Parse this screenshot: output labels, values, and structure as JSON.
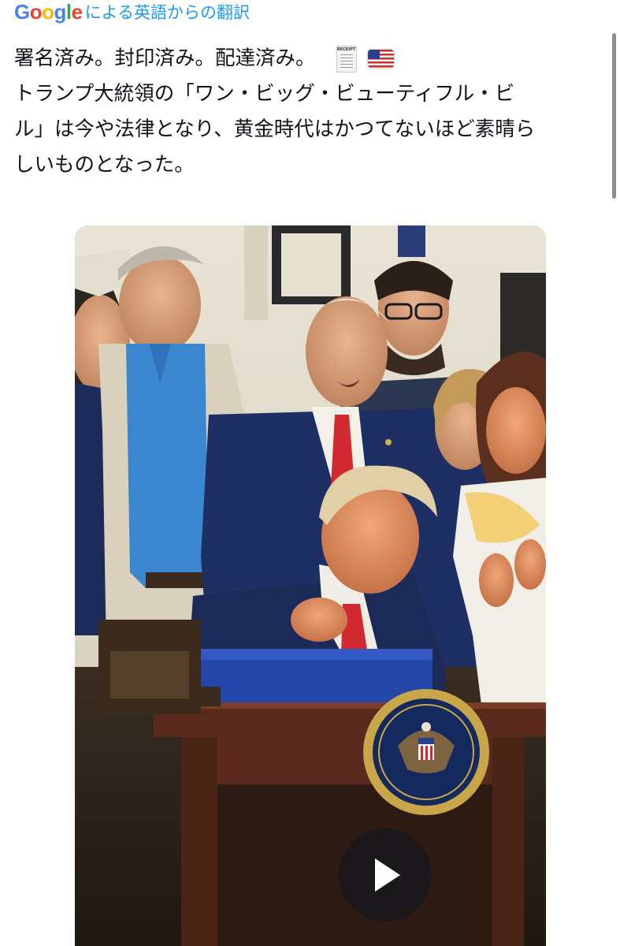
{
  "translation_header": {
    "logo_text": "Google",
    "label": "による英語からの翻訳",
    "logo_colors": [
      "#4285F4",
      "#EA4335",
      "#FBBC05",
      "#4285F4",
      "#34A853",
      "#EA4335"
    ]
  },
  "tweet": {
    "line1": "署名済み。封印済み。配達済み。",
    "receipt_emoji_text": "RECEIPT",
    "line2": "トランプ大統領の「ワン・ビッグ・ビューティフル・ビ",
    "line3": "ル」は今や法律となり、黄金時代はかつてないほど素晴ら",
    "line4": "しいものとなった。",
    "emojis": [
      "receipt-icon",
      "us-flag-icon"
    ]
  },
  "video": {
    "play_icon": "play-icon",
    "colors": {
      "accent_red": "#d22a30",
      "suit_navy": "#1e2f63",
      "seal_gold": "#c9a649"
    }
  }
}
